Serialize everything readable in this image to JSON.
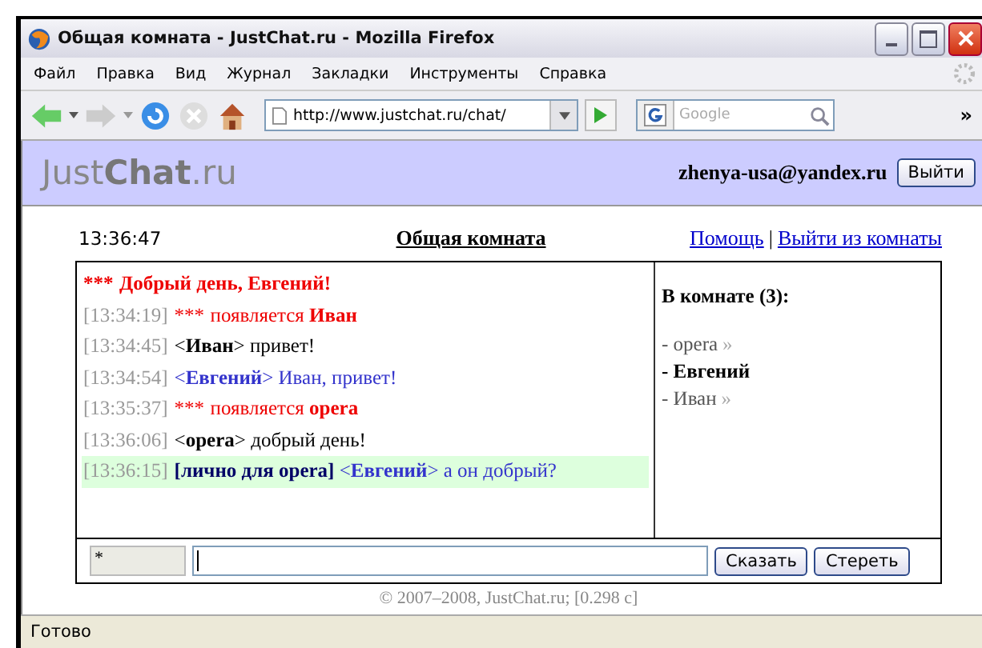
{
  "window": {
    "title": "Общая комната - JustChat.ru - Mozilla Firefox"
  },
  "menu": [
    "Файл",
    "Правка",
    "Вид",
    "Журнал",
    "Закладки",
    "Инструменты",
    "Справка"
  ],
  "toolbar": {
    "url": "http://www.justchat.ru/chat/",
    "search_placeholder": "Google",
    "overflow": "»"
  },
  "site": {
    "logo_light": "Just",
    "logo_bold": "Chat",
    "logo_tail": ".ru",
    "user": "zhenya-usa@yandex.ru",
    "logout": "Выйти"
  },
  "chat": {
    "clock": "13:36:47",
    "room": "Общая комната",
    "help": "Помощь",
    "separator": "|",
    "leave": "Выйти из комнаты",
    "messages": [
      {
        "kind": "greeting",
        "prefix": "***",
        "text": "Добрый день, Евгений!"
      },
      {
        "kind": "system",
        "time": "[13:34:19]",
        "prefix": "***",
        "text": "появляется **Иван**"
      },
      {
        "kind": "message",
        "time": "[13:34:45]",
        "text": "<**Иван**> привет!"
      },
      {
        "kind": "own",
        "time": "[13:34:54]",
        "text": "<**Евгений**> Иван, привет!"
      },
      {
        "kind": "system",
        "time": "[13:35:37]",
        "prefix": "***",
        "text": "появляется **opera**"
      },
      {
        "kind": "message",
        "time": "[13:36:06]",
        "text": "<**opera**> добрый день!"
      },
      {
        "kind": "private",
        "time": "[13:36:15]",
        "text": "**[лично для opera]** <**Евгений**> а он добрый?"
      }
    ],
    "users_title": "В комнате (3):",
    "users": [
      {
        "name": "- opera",
        "self": false,
        "arrow": "»"
      },
      {
        "name": "- Евгений",
        "self": true
      },
      {
        "name": "- Иван",
        "self": false,
        "arrow": "»"
      }
    ],
    "recipient": "*",
    "say": "Сказать",
    "clear": "Стереть"
  },
  "footer": "© 2007–2008, JustChat.ru; [0.298 с]",
  "status_bar": "Готово"
}
